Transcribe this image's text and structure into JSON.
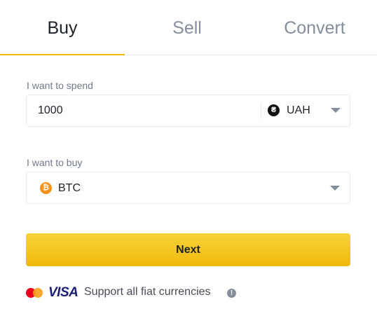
{
  "tabs": [
    {
      "label": "Buy",
      "active": true
    },
    {
      "label": "Sell",
      "active": false
    },
    {
      "label": "Convert",
      "active": false
    }
  ],
  "spend": {
    "label": "I want to spend",
    "amount": "1000",
    "currency": {
      "code": "UAH",
      "icon": "hryvnia-icon",
      "symbol": "₴"
    }
  },
  "buy": {
    "label": "I want to buy",
    "crypto": {
      "code": "BTC",
      "icon": "bitcoin-icon",
      "symbol": "₿"
    }
  },
  "next_button": "Next",
  "footer": {
    "visa": "VISA",
    "support_text": "Support all fiat currencies",
    "info_symbol": "!"
  },
  "colors": {
    "accent": "#f0b90b",
    "bitcoin": "#f7931a",
    "visa_blue": "#1a1f71",
    "mastercard_red": "#eb001b",
    "mastercard_orange": "#f79e1b"
  }
}
